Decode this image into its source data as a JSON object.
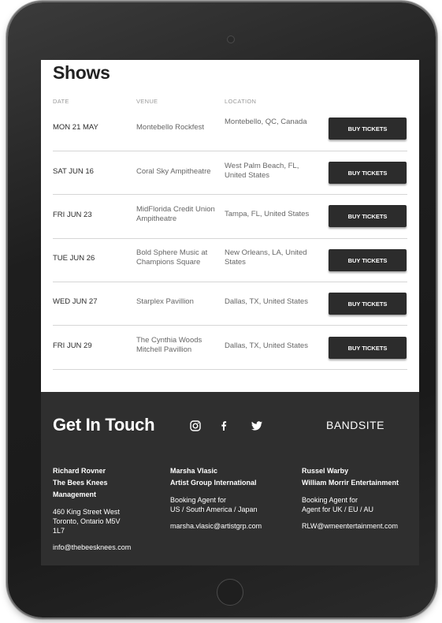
{
  "shows": {
    "title": "Shows",
    "columns": [
      "DATE",
      "VENUE",
      "LOCATION"
    ],
    "rows": [
      {
        "date": "MON 21 MAY",
        "venue": "Montebello Rockfest",
        "location": "Montebello, QC, Canada",
        "button": "BUY TICKETS"
      },
      {
        "date": "SAT JUN 16",
        "venue": "Coral Sky Ampitheatre",
        "location": "West Palm Beach, FL, United States",
        "button": "BUY TICKETS"
      },
      {
        "date": "FRI JUN 23",
        "venue": "MidFlorida Credit Union Ampitheatre",
        "location": "Tampa, FL, United States",
        "button": "BUY TICKETS"
      },
      {
        "date": "TUE JUN 26",
        "venue": "Bold Sphere Music at Champions Square",
        "location": "New Orleans, LA, United States",
        "button": "BUY TICKETS"
      },
      {
        "date": "WED JUN 27",
        "venue": "Starplex Pavillion",
        "location": "Dallas, TX, United States",
        "button": "BUY TICKETS"
      },
      {
        "date": "FRI JUN 29",
        "venue": "The Cynthia Woods Mitchell Pavillion",
        "location": "Dallas, TX, United States",
        "button": "BUY TICKETS"
      }
    ]
  },
  "footer": {
    "title": "Get In Touch",
    "social_icons": [
      "instagram-icon",
      "facebook-icon",
      "twitter-icon"
    ],
    "logo": "BANDSITE",
    "contacts": [
      {
        "name_lines": [
          "Richard Rovner",
          "The Bees Knees",
          "Management"
        ],
        "detail_lines": [
          "460 King Street West",
          "Toronto, Ontario M5V",
          "1L7"
        ],
        "email": "info@thebeesknees.com"
      },
      {
        "name_lines": [
          "Marsha Vlasic",
          "Artist Group International"
        ],
        "detail_lines": [
          "Booking Agent for",
          "US / South America / Japan"
        ],
        "email": "marsha.vlasic@artistgrp.com"
      },
      {
        "name_lines": [
          "Russel Warby",
          "William Morrir Entertainment"
        ],
        "detail_lines": [
          "Booking Agent for",
          "Agent for UK / EU / AU"
        ],
        "email": "RLW@wmeentertainment.com"
      }
    ]
  },
  "colors": {
    "footer_bg": "#2f2f2f",
    "button_bg": "#2c2c2c",
    "device_frame": "#1e1e1e"
  }
}
